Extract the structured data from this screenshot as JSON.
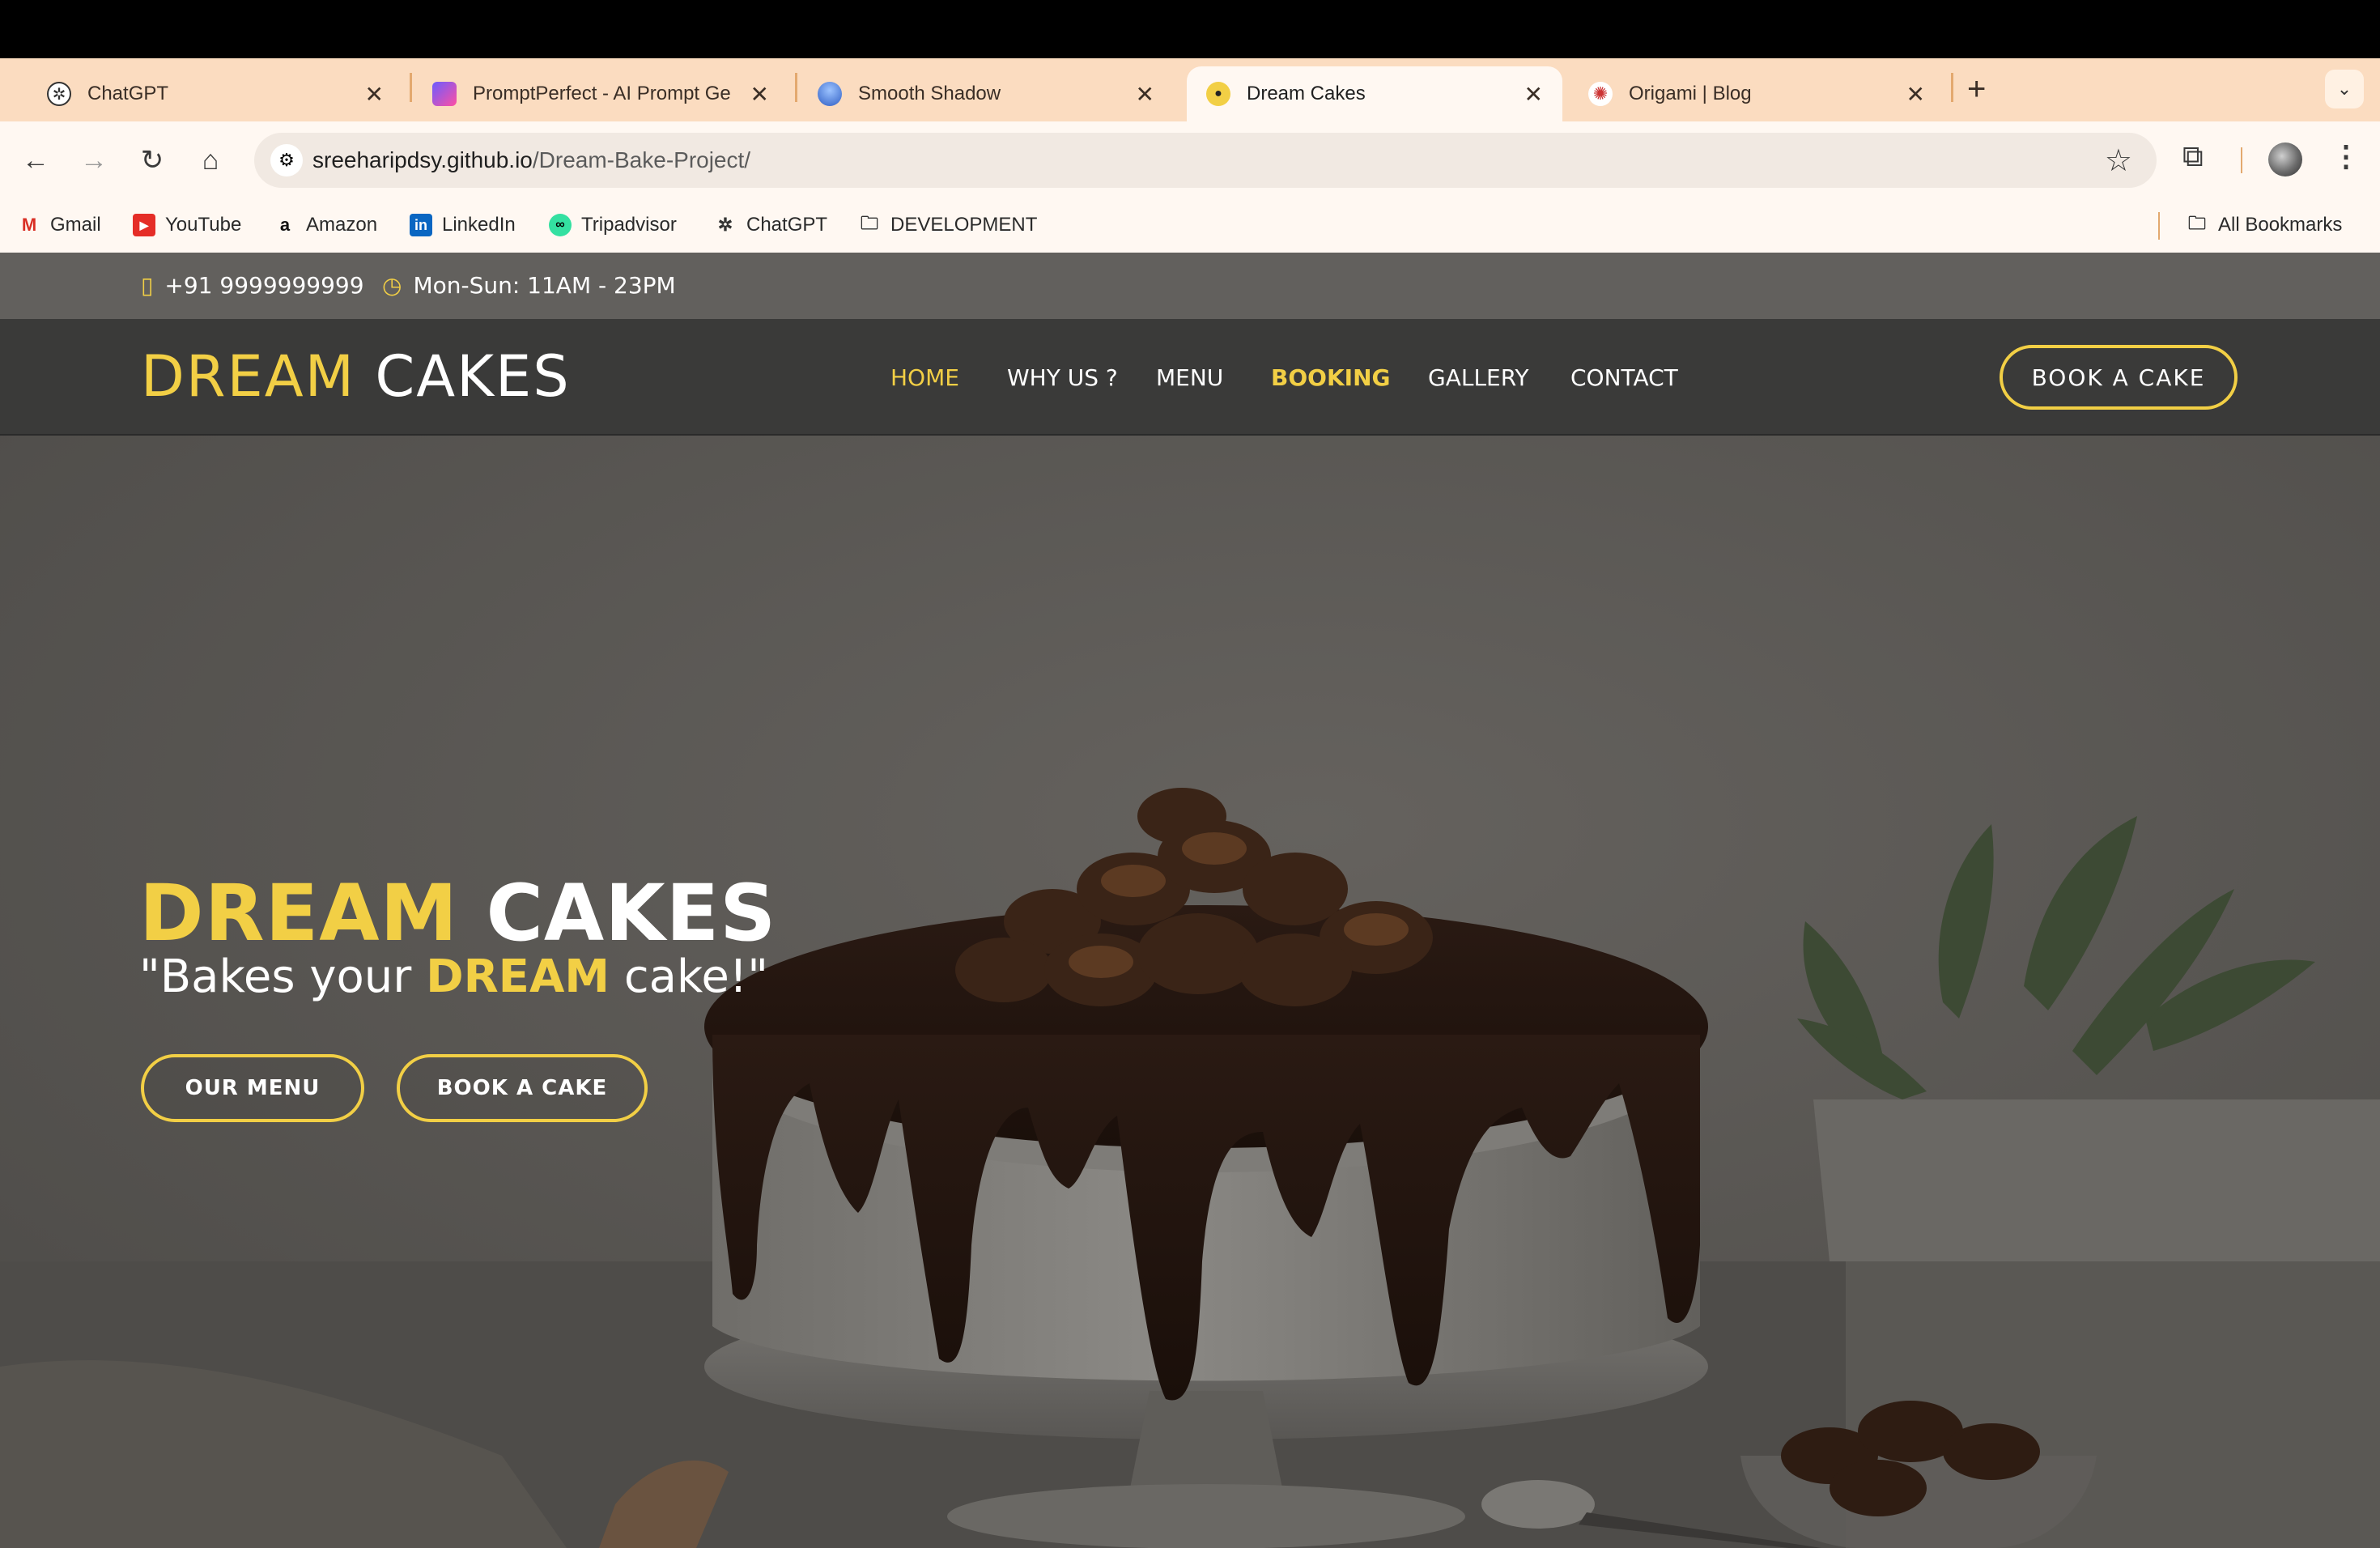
{
  "browser": {
    "tabs": [
      {
        "title": "ChatGPT",
        "icon": "chatgpt-icon",
        "active": false
      },
      {
        "title": "PromptPerfect - AI Prompt Ge",
        "icon": "promptperfect-icon",
        "active": false
      },
      {
        "title": "Smooth Shadow",
        "icon": "smooth-shadow-icon",
        "active": false
      },
      {
        "title": "Dream Cakes",
        "icon": "dream-cakes-icon",
        "active": true
      },
      {
        "title": "Origami | Blog",
        "icon": "origami-icon",
        "active": false
      }
    ],
    "url_host": "sreeharipdsy.github.io",
    "url_path": "/Dream-Bake-Project/",
    "bookmarks": [
      {
        "label": "Gmail",
        "icon": "gmail-icon"
      },
      {
        "label": "YouTube",
        "icon": "youtube-icon"
      },
      {
        "label": "Amazon",
        "icon": "amazon-icon"
      },
      {
        "label": "LinkedIn",
        "icon": "linkedin-icon"
      },
      {
        "label": "Tripadvisor",
        "icon": "tripadvisor-icon"
      },
      {
        "label": "ChatGPT",
        "icon": "chatgpt-icon"
      },
      {
        "label": "DEVELOPMENT",
        "icon": "folder-icon"
      }
    ],
    "all_bookmarks": "All Bookmarks"
  },
  "site": {
    "info": {
      "phone": "+91 9999999999",
      "hours": "Mon-Sun: 11AM - 23PM"
    },
    "brand": {
      "first": "DREAM",
      "second": "CAKES"
    },
    "nav": [
      {
        "label": "HOME",
        "state": "active"
      },
      {
        "label": "WHY US ?",
        "state": "normal"
      },
      {
        "label": "MENU",
        "state": "normal"
      },
      {
        "label": "BOOKING",
        "state": "bold"
      },
      {
        "label": "GALLERY",
        "state": "normal"
      },
      {
        "label": "CONTACT",
        "state": "normal"
      }
    ],
    "nav_cta": "BOOK A CAKE",
    "hero": {
      "title_first": "DREAM",
      "title_second": "CAKES",
      "tag_open": "\"Bakes your ",
      "tag_highlight": "DREAM",
      "tag_close": " cake!\"",
      "btn_menu": "OUR MENU",
      "btn_book": "BOOK A CAKE"
    }
  },
  "colors": {
    "accent": "#f2cf45",
    "nav_bg": "#3a3a39",
    "tab_strip": "#fbdcc0"
  }
}
